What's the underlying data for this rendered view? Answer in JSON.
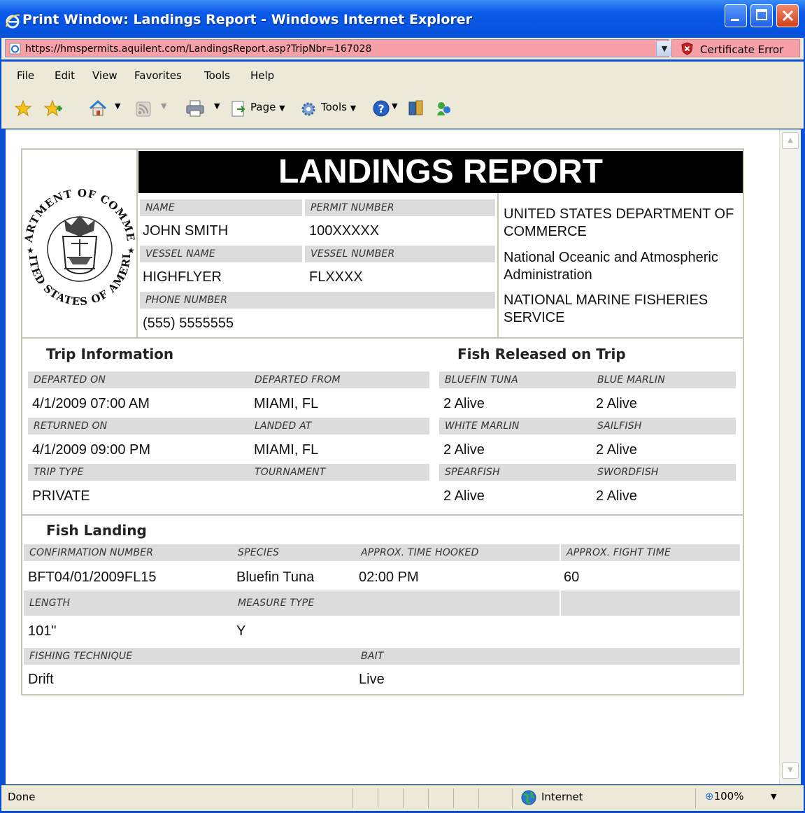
{
  "window": {
    "title": "Print Window: Landings Report - Windows Internet Explorer",
    "url": "https://hmspermits.aquilent.com/LandingsReport.asp?TripNbr=167028",
    "cert_error": "Certificate Error"
  },
  "menu": [
    "File",
    "Edit",
    "View",
    "Favorites",
    "Tools",
    "Help"
  ],
  "toolbar": {
    "page_label": "Page",
    "tools_label": "Tools"
  },
  "status": {
    "text": "Done",
    "zone": "Internet",
    "zoom": "100%"
  },
  "report": {
    "title": "LANDINGS REPORT",
    "seal_top": "DEPARTMENT OF COMMERCE",
    "seal_bottom": "UNITED STATES OF AMERICA",
    "header": {
      "name_label": "NAME",
      "name": "JOHN SMITH",
      "permit_label": "PERMIT NUMBER",
      "permit": "100XXXXX",
      "vessel_name_label": "VESSEL NAME",
      "vessel_name": "HIGHFLYER",
      "vessel_number_label": "VESSEL NUMBER",
      "vessel_number": "FLXXXX",
      "phone_label": "PHONE NUMBER",
      "phone": "(555) 5555555"
    },
    "org": {
      "line1": "UNITED STATES DEPARTMENT OF COMMERCE",
      "line2": "National Oceanic and Atmospheric Administration",
      "line3": "NATIONAL MARINE FISHERIES SERVICE"
    },
    "trip": {
      "heading": "Trip Information",
      "departed_on_label": "DEPARTED ON",
      "departed_on": "4/1/2009 07:00 AM",
      "departed_from_label": "DEPARTED FROM",
      "departed_from": "MIAMI, FL",
      "returned_on_label": "RETURNED ON",
      "returned_on": "4/1/2009 09:00 PM",
      "landed_at_label": "LANDED AT",
      "landed_at": "MIAMI, FL",
      "trip_type_label": "TRIP TYPE",
      "trip_type": "PRIVATE",
      "tournament_label": "TOURNAMENT",
      "tournament": ""
    },
    "released": {
      "heading": "Fish Released on Trip",
      "bluefin_label": "BLUEFIN TUNA",
      "bluefin": "2 Alive",
      "blue_marlin_label": "BLUE MARLIN",
      "blue_marlin": "2 Alive",
      "white_marlin_label": "WHITE MARLIN",
      "white_marlin": "2 Alive",
      "sailfish_label": "SAILFISH",
      "sailfish": "2 Alive",
      "spearfish_label": "SPEARFISH",
      "spearfish": "2 Alive",
      "swordfish_label": "SWORDFISH",
      "swordfish": "2 Alive"
    },
    "landing": {
      "heading": "Fish Landing",
      "confirmation_label": "CONFIRMATION NUMBER",
      "confirmation": "BFT04/01/2009FL15",
      "species_label": "SPECIES",
      "species": "Bluefin Tuna",
      "time_hooked_label": "APPROX. TIME HOOKED",
      "time_hooked": "02:00 PM",
      "fight_time_label": "APPROX. FIGHT TIME",
      "fight_time": "60",
      "length_label": "LENGTH",
      "length": "101\"",
      "measure_label": "MEASURE TYPE",
      "measure": "Y",
      "technique_label": "FISHING TECHNIQUE",
      "technique": "Drift",
      "bait_label": "BAIT",
      "bait": "Live"
    }
  }
}
